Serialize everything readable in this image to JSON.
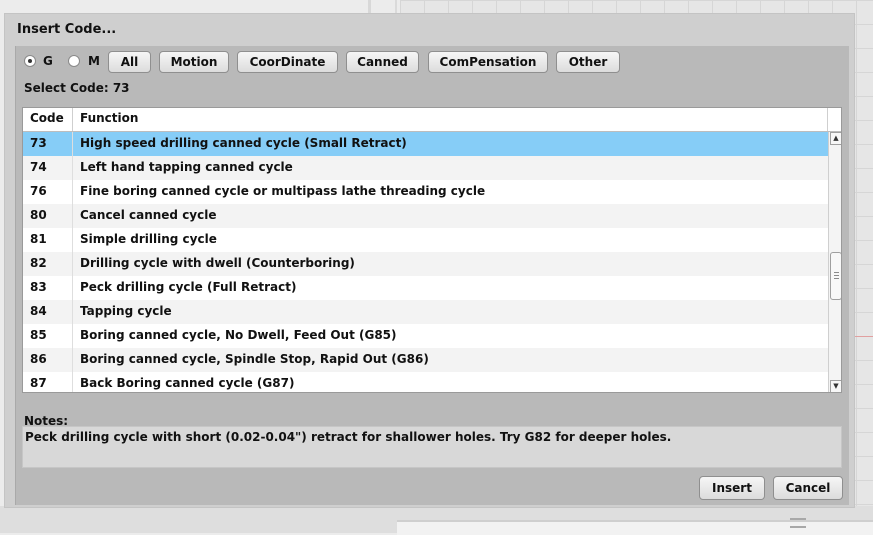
{
  "dialog": {
    "title": "Insert Code..."
  },
  "mode": {
    "options": [
      {
        "label": "G",
        "selected": true
      },
      {
        "label": "M",
        "selected": false
      }
    ]
  },
  "filters": [
    "All",
    "Motion",
    "CoorDinate",
    "Canned",
    "ComPensation",
    "Other"
  ],
  "select_code": {
    "text": "Select Code: 73"
  },
  "table": {
    "headers": {
      "code": "Code",
      "function": "Function"
    },
    "selected_code": "73",
    "rows": [
      {
        "code": "73",
        "function": "High speed drilling canned cycle (Small Retract)"
      },
      {
        "code": "74",
        "function": "Left hand tapping canned cycle"
      },
      {
        "code": "76",
        "function": "Fine boring canned cycle or multipass lathe threading cycle"
      },
      {
        "code": "80",
        "function": "Cancel canned cycle"
      },
      {
        "code": "81",
        "function": "Simple drilling cycle"
      },
      {
        "code": "82",
        "function": "Drilling cycle with dwell (Counterboring)"
      },
      {
        "code": "83",
        "function": "Peck drilling cycle (Full Retract)"
      },
      {
        "code": "84",
        "function": "Tapping cycle"
      },
      {
        "code": "85",
        "function": "Boring canned cycle, No Dwell, Feed Out (G85)"
      },
      {
        "code": "86",
        "function": "Boring canned cycle, Spindle Stop, Rapid Out (G86)"
      },
      {
        "code": "87",
        "function": "Back Boring canned cycle (G87)"
      }
    ],
    "scroll_up_glyph": "▲",
    "scroll_down_glyph": "▼"
  },
  "notes": {
    "label": "Notes:",
    "text": "Peck drilling cycle with short (0.02-0.04\") retract for shallower holes.  Try G82 for deeper holes."
  },
  "actions": {
    "insert": "Insert",
    "cancel": "Cancel"
  },
  "colors": {
    "selected_row": "#86cdf7",
    "dialog": "#cfcfcf",
    "panel": "#b9b9b9"
  }
}
